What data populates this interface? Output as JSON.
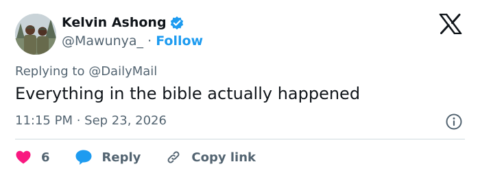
{
  "header": {
    "display_name": "Kelvin Ashong",
    "handle": "@Mawunya_",
    "separator": "·",
    "follow_label": "Follow",
    "verified": true,
    "logo": "x-logo-icon"
  },
  "tweet": {
    "reply_context": "Replying to @DailyMail",
    "text": "Everything in the bible actually happened",
    "timestamp": "11:15 PM · Sep 23, 2026"
  },
  "actions": {
    "like_count": "6",
    "reply_label": "Reply",
    "copy_link_label": "Copy link"
  },
  "colors": {
    "accent": "#1d9bf0",
    "heart": "#f91880",
    "muted": "#536471",
    "text": "#0f1419",
    "divider": "#cfd9de"
  }
}
